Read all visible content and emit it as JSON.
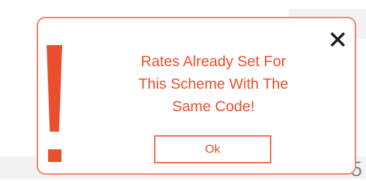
{
  "background": {
    "partial_digit": "5"
  },
  "dialog": {
    "message_lines": [
      "Rates Already Set For",
      "This Scheme With The",
      "Same Code!"
    ],
    "ok_label": "Ok",
    "icons": {
      "alert": "exclamation-icon",
      "close": "close-icon"
    }
  },
  "colors": {
    "accent": "#ea4f2d",
    "border": "#f0826a",
    "close_icon": "#1a1a1a"
  }
}
